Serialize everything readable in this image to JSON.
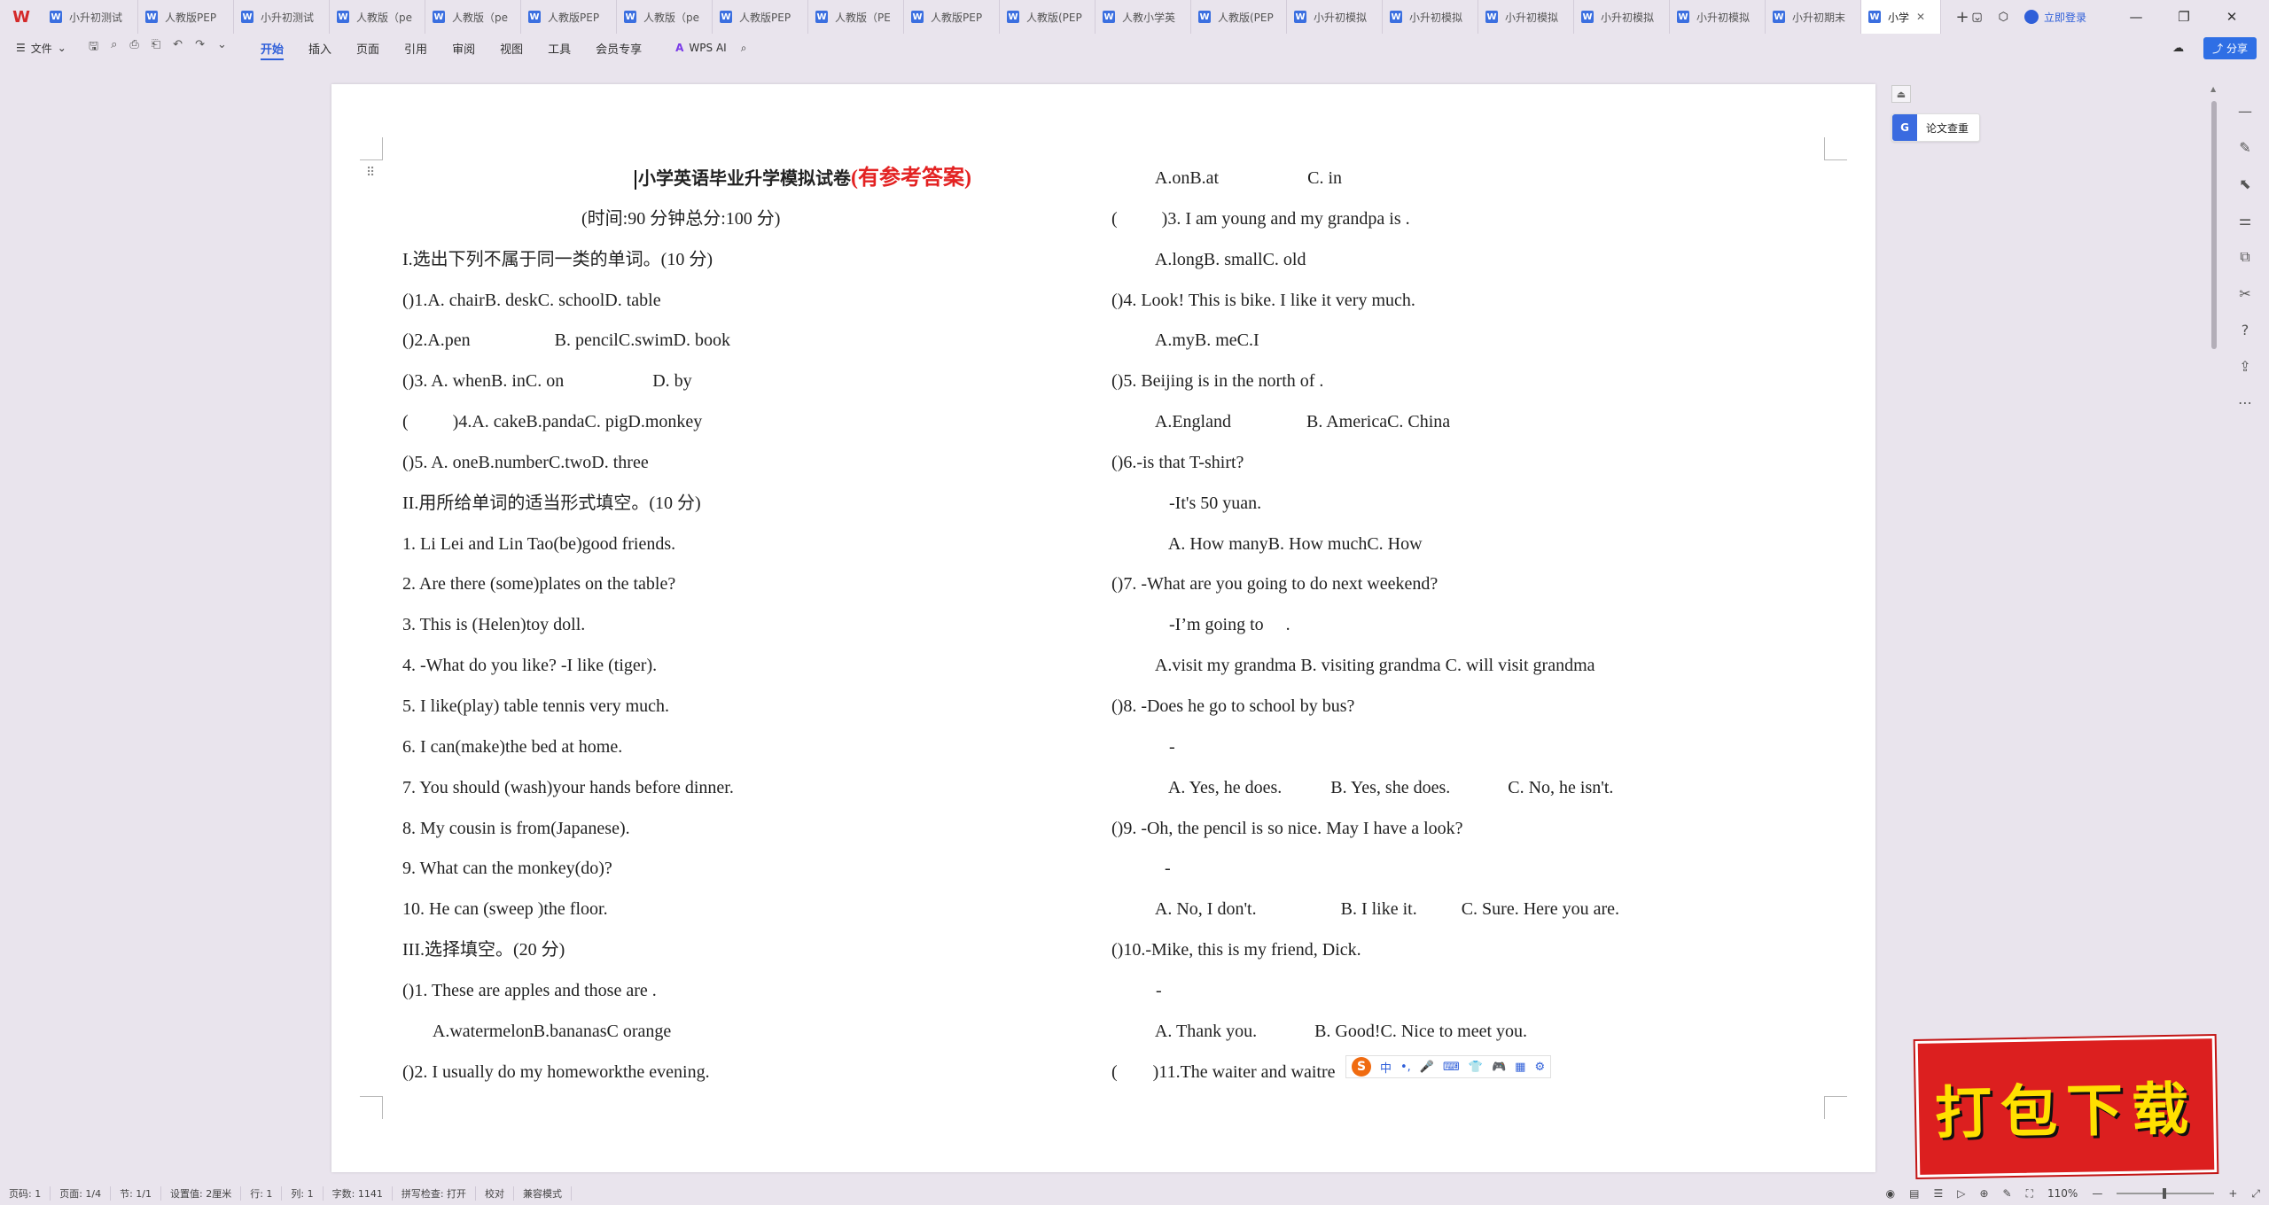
{
  "tabbar": {
    "logo": "W",
    "tabs": [
      {
        "label": "小升初测试"
      },
      {
        "label": "人教版PEP"
      },
      {
        "label": "小升初测试"
      },
      {
        "label": "人教版（pe"
      },
      {
        "label": "人教版（pe"
      },
      {
        "label": "人教版PEP"
      },
      {
        "label": "人教版（pe"
      },
      {
        "label": "人教版PEP"
      },
      {
        "label": "人教版（PE"
      },
      {
        "label": "人教版PEP"
      },
      {
        "label": "人教版(PEP"
      },
      {
        "label": "人教小学英"
      },
      {
        "label": "人教版(PEP"
      },
      {
        "label": "小升初模拟"
      },
      {
        "label": "小升初模拟"
      },
      {
        "label": "小升初模拟"
      },
      {
        "label": "小升初模拟"
      },
      {
        "label": "小升初模拟"
      },
      {
        "label": "小升初期末"
      }
    ],
    "active_tab": "小学",
    "login": "立即登录"
  },
  "ribbon": {
    "file": "文件",
    "tabs": [
      "开始",
      "插入",
      "页面",
      "引用",
      "审阅",
      "视图",
      "工具",
      "会员专享"
    ],
    "active": "开始",
    "wps_ai": "WPS AI",
    "share": "分享"
  },
  "side": {
    "plagiarism": "论文查重"
  },
  "document": {
    "title_main": "小学英语毕业升学模拟试卷",
    "title_answer": "(有参考答案)",
    "subtitle": "(时间:90 分钟总分:100 分)",
    "left_lines": [
      "I.选出下列不属于同一类的单词。(10 分)",
      "()1.A. chairB. deskC. schoolD. table",
      "()2.A.pen                   B. pencilC.swimD. book",
      "()3. A. whenB. inC. on                    D. by",
      "(          )4.A. cakeB.pandaC. pigD.monkey",
      "()5. A. oneB.numberC.twoD. three",
      "II.用所给单词的适当形式填空。(10 分)",
      "1. Li Lei and Lin Tao(be)good friends.",
      "2. Are there (some)plates on the table?",
      "3. This is (Helen)toy doll.",
      "4. -What do you like? -I like (tiger).",
      "5. I like(play) table tennis very much.",
      "6. I can(make)the bed at home.",
      "7. You should (wash)your hands before dinner.",
      "8. My cousin is from(Japanese).",
      "9. What can the monkey(do)?",
      "10. He can (sweep )the floor.",
      "III.选择填空。(20 分)",
      "()1. These are apples and those are .",
      "       A.watermelonB.bananasC orange",
      "()2. I usually do my homeworkthe evening."
    ],
    "right_lines": [
      "          A.onB.at                    C. in",
      "(          )3. I am young and my grandpa is .",
      "          A.longB. smallC. old",
      "()4. Look! This is bike. I like it very much.",
      "          A.myB. meC.I",
      "()5. Beijing is in the north of .",
      "          A.England                 B. AmericaC. China",
      "()6.-is that T-shirt?",
      "             -It's 50 yuan.",
      "             A. How manyB. How muchC. How",
      "()7. -What are you going to do next weekend?",
      "             -I’m going to     .",
      "          A.visit my grandma B. visiting grandma C. will visit grandma",
      "()8. -Does he go to school by bus?",
      "             -",
      "             A. Yes, he does.           B. Yes, she does.             C. No, he isn't.",
      "()9. -Oh, the pencil is so nice. May I have a look?",
      "            -",
      "          A. No, I don't.                   B. I like it.          C. Sure. Here you are.",
      "()10.-Mike, this is my friend, Dick.",
      "          -",
      "          A. Thank you.             B. Good!C. Nice to meet you.",
      "(        )11.The waiter and waitre"
    ]
  },
  "ime": {
    "items": [
      "中",
      "•,",
      "🎤",
      "⌨",
      "👕",
      "🎮",
      "▦",
      "⚙"
    ]
  },
  "statusbar": {
    "page_code": "页码: 1",
    "pages": "页面: 1/4",
    "section": "节: 1/1",
    "setting": "设置值: 2厘米",
    "row": "行: 1",
    "col": "列: 1",
    "words": "字数: 1141",
    "spell": "拼写检查: 打开",
    "proof": "校对",
    "compat": "兼容模式",
    "zoom": "110%"
  },
  "badge": {
    "text": "打包下载"
  }
}
